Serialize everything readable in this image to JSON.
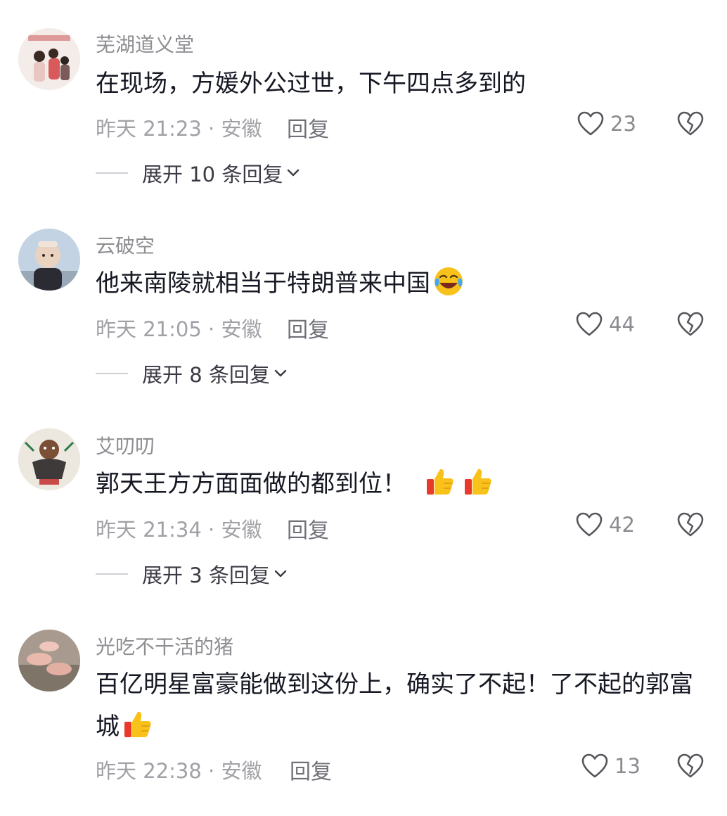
{
  "comments": [
    {
      "username": "芜湖道义堂",
      "text": "在现场，方媛外公过世，下午四点多到的",
      "meta": "昨天 21:23 · 安徽",
      "reply_label": "回复",
      "likes": "23",
      "expand_label": "展开 10 条回复",
      "avatar_icon": "avatar-photo-group",
      "emojis": []
    },
    {
      "username": "云破空",
      "text": "他来南陵就相当于特朗普来中国",
      "meta": "昨天 21:05 · 安徽",
      "reply_label": "回复",
      "likes": "44",
      "expand_label": "展开 8 条回复",
      "avatar_icon": "avatar-photo-child",
      "emojis": [
        "crying-laughing-emoji"
      ]
    },
    {
      "username": "艾叨叨",
      "text": "郭天王方方面面做的都到位！",
      "meta": "昨天 21:34 · 安徽",
      "reply_label": "回复",
      "likes": "42",
      "expand_label": "展开 3 条回复",
      "avatar_icon": "avatar-photo-illustration",
      "emojis": [
        "thumbs-up-emoji",
        "thumbs-up-emoji"
      ]
    },
    {
      "username": "光吃不干活的猪",
      "text": "百亿明星富豪能做到这份上，确实了不起！了不起的郭富城",
      "meta": "昨天 22:38 · 安徽",
      "reply_label": "回复",
      "likes": "13",
      "avatar_icon": "avatar-photo-pigs",
      "emojis": [
        "thumbs-up-emoji"
      ]
    }
  ],
  "colors": {
    "text_primary": "#161823",
    "text_secondary": "#8e8e93",
    "icon_gray": "#55555c",
    "emoji_yellow": "#f9c21b",
    "emoji_red": "#e8392b"
  }
}
